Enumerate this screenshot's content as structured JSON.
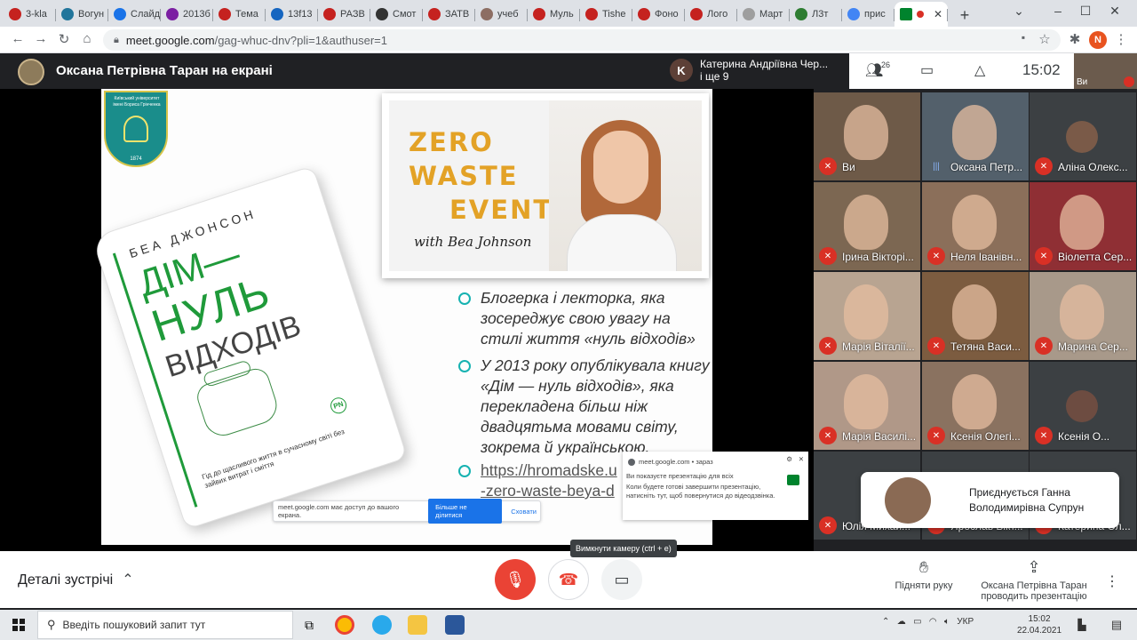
{
  "browser": {
    "tabs": [
      {
        "label": "3-kla",
        "color": "#c5221f"
      },
      {
        "label": "Вогун",
        "color": "#21759b"
      },
      {
        "label": "Слайд",
        "color": "#1a73e8"
      },
      {
        "label": "2013б",
        "color": "#7b1fa2"
      },
      {
        "label": "Тема",
        "color": "#c5221f"
      },
      {
        "label": "13f13",
        "color": "#1565c0"
      },
      {
        "label": "РАЗВ",
        "color": "#c5221f"
      },
      {
        "label": "Смот",
        "color": "#333333"
      },
      {
        "label": "ЗАТВ",
        "color": "#c5221f"
      },
      {
        "label": "учеб",
        "color": "#8d6e63"
      },
      {
        "label": "Муль",
        "color": "#c5221f"
      },
      {
        "label": "Tishe",
        "color": "#c5221f"
      },
      {
        "label": "Фоно",
        "color": "#c5221f"
      },
      {
        "label": "Лого",
        "color": "#c5221f"
      },
      {
        "label": "Март",
        "color": "#9e9e9e"
      },
      {
        "label": "Л3т",
        "color": "#2e7d32"
      },
      {
        "label": "прис",
        "color": "#4285f4"
      }
    ],
    "active_tab": {
      "label": ""
    },
    "new_tab": "+",
    "url_host": "meet.google.com",
    "url_path": "/gag-whuc-dnv?pli=1&authuser=1",
    "profile_initial": "N"
  },
  "meet": {
    "presenter_title": "Оксана Петрівна Таран на екрані",
    "speaker_initial": "K",
    "speaker_name": "Катерина Андріївна Чер...",
    "speaker_more": "і ще 9",
    "participant_count": "26",
    "clock": "15:02",
    "self_label": "Ви"
  },
  "logo": {
    "line1": "Київський університет",
    "line2": "імені Бориса Грінченка",
    "year": "1874"
  },
  "book": {
    "author": "БЕА ДЖОНСОН",
    "title1": "ДІМ—",
    "title2": "НУЛЬ",
    "title3": "ВІДХОДІВ",
    "subtitle": "Гід до щасливого життя в сучасному світі без зайвих витрат і сміття",
    "publisher": "PN"
  },
  "zw": {
    "line1": "ZERO",
    "line2": "WASTE",
    "line3": "EVENT",
    "with": "with Bea Johnson"
  },
  "bullets": [
    "Блогерка і лекторка, яка зосереджує свою увагу на стилі життя «нуль відходів»",
    "У 2013 року опублікувала книгу «Дім — нуль відходів», яка перекладена більш ніж двадцятьма мовами світу, зокрема й українською."
  ],
  "link": {
    "line1": "https://hromadske.u",
    "line2": "-zero-waste-beya-d"
  },
  "sharebar": {
    "text": "meet.google.com має доступ до вашого екрана.",
    "stop": "Більше не ділитися",
    "hide": "Сховати"
  },
  "notification": {
    "source": "meet.google.com",
    "time": "• зараз",
    "title": "Ви показуєте презентацію для всіх",
    "body": "Коли будете готові завершити презентацію, натисніть тут, щоб повернутися до відеодзвінка."
  },
  "tiles": [
    {
      "name": "Ви",
      "muted": true,
      "bg": "#6e5a48"
    },
    {
      "name": "Оксана Петр...",
      "muted": false,
      "bg": "#53606b"
    },
    {
      "name": "Аліна Олекс...",
      "muted": true,
      "bg": "#3c4043",
      "avatar": "#7a5a48"
    },
    {
      "name": "Ірина Вікторі...",
      "muted": true,
      "bg": "#7c6752"
    },
    {
      "name": "Неля Іванівн...",
      "muted": true,
      "bg": "#8b6f5a"
    },
    {
      "name": "Віолетта Сер...",
      "muted": true,
      "bg": "#8f2f34"
    },
    {
      "name": "Марія Віталії...",
      "muted": true,
      "bg": "#b8a491"
    },
    {
      "name": "Тетяна Васи...",
      "muted": true,
      "bg": "#7c5c40"
    },
    {
      "name": "Марина Сер...",
      "muted": true,
      "bg": "#a8998a"
    },
    {
      "name": "Марія Василі...",
      "muted": true,
      "bg": "#b09888"
    },
    {
      "name": "Ксенія Олегі...",
      "muted": true,
      "bg": "#8a7260"
    },
    {
      "name": "Ксенія О...",
      "muted": true,
      "bg": "#3c4043",
      "avatar": "#6d4c41"
    },
    {
      "name": "Юлія Михай...",
      "muted": true,
      "bg": "#3c4043"
    },
    {
      "name": "Ярослав Вікт...",
      "muted": true,
      "bg": "#3c4043"
    },
    {
      "name": "Катерина Ол...",
      "muted": true,
      "bg": "#3c4043"
    }
  ],
  "join_notice": {
    "line1": "Приєднується Ганна",
    "line2": "Володимирівна Супрун"
  },
  "controls": {
    "details": "Деталі зустрічі",
    "tooltip": "Вимкнути камеру (ctrl + e)",
    "raise_hand": "Підняти руку",
    "presenting_line1": "Оксана Петрівна Таран",
    "presenting_line2": "проводить презентацію"
  },
  "taskbar": {
    "search_placeholder": "Введіть пошуковий запит тут",
    "lang": "УКР",
    "time": "15:02",
    "date": "22.04.2021"
  }
}
